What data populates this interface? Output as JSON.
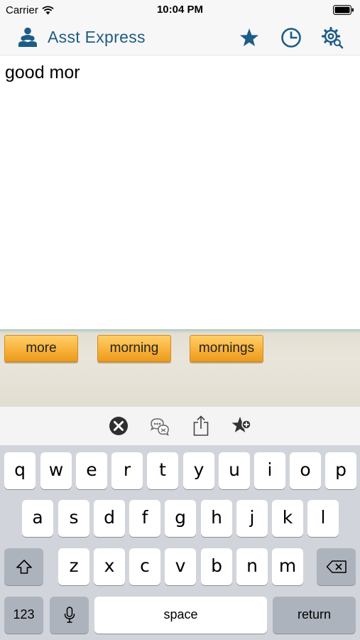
{
  "status_bar": {
    "carrier": "Carrier",
    "time": "10:04 PM"
  },
  "nav": {
    "title": "Asst Express",
    "accent_color": "#1d5c87",
    "icons": [
      "people-logo-icon",
      "star-icon",
      "history-clock-icon",
      "settings-gear-icon"
    ]
  },
  "editor": {
    "text": "good mor"
  },
  "suggestions": [
    "more",
    "morning",
    "mornings"
  ],
  "toolbar": {
    "icons": [
      "clear-x-icon",
      "speak-chat-icon",
      "share-icon",
      "add-favorite-icon"
    ]
  },
  "keyboard": {
    "row1": [
      "q",
      "w",
      "e",
      "r",
      "t",
      "y",
      "u",
      "i",
      "o",
      "p"
    ],
    "row2": [
      "a",
      "s",
      "d",
      "f",
      "g",
      "h",
      "j",
      "k",
      "l"
    ],
    "row3": [
      "z",
      "x",
      "c",
      "v",
      "b",
      "n",
      "m"
    ],
    "numbers_label": "123",
    "space_label": "space",
    "return_label": "return"
  }
}
